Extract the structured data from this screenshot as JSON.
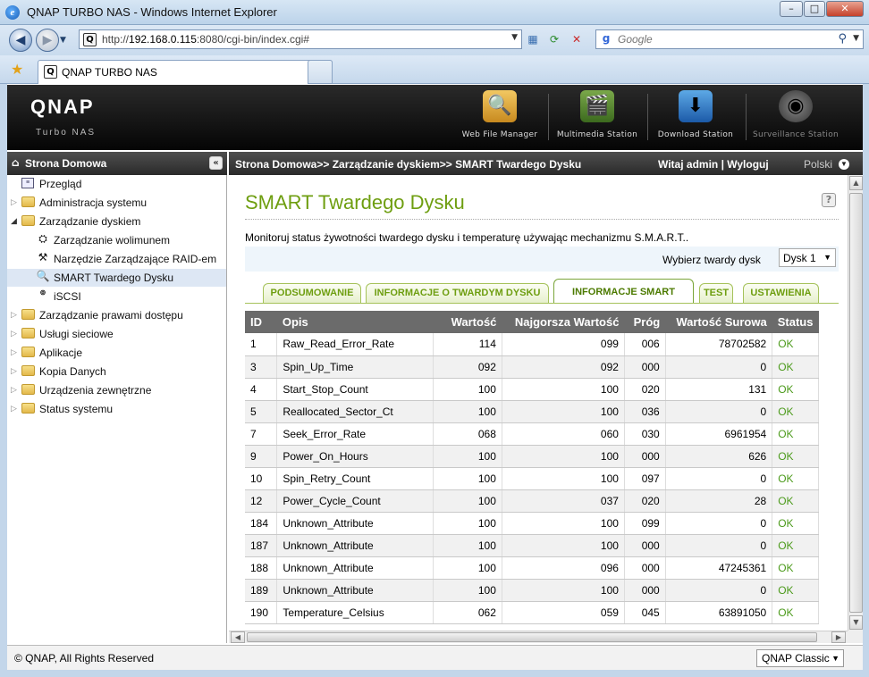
{
  "window": {
    "title": "QNAP TURBO NAS - Windows Internet Explorer",
    "controls": {
      "minimize": "–",
      "maximize": "□",
      "close": "✕"
    }
  },
  "browser": {
    "url_prefix": "http://",
    "url_host": "192.168.0.115",
    "url_rest": ":8080/cgi-bin/index.cgi#",
    "search_placeholder": "Google",
    "tab_title": "QNAP TURBO NAS"
  },
  "header": {
    "logo": "QNAP",
    "subtitle": "Turbo NAS",
    "stations": [
      {
        "label": "Web File Manager",
        "icon": "folder-magnifier-icon"
      },
      {
        "label": "Multimedia Station",
        "icon": "media-icon"
      },
      {
        "label": "Download Station",
        "icon": "download-icon"
      },
      {
        "label": "Surveillance Station",
        "icon": "camera-icon"
      }
    ]
  },
  "sidebar": {
    "title": "Strona Domowa",
    "items": [
      {
        "label": "Przegląd",
        "type": "page",
        "icon": "overview-icon"
      },
      {
        "label": "Administracja systemu",
        "type": "folder",
        "expanded": false
      },
      {
        "label": "Zarządzanie dyskiem",
        "type": "folder",
        "expanded": true
      },
      {
        "label": "Zarządzanie wolimunem",
        "type": "child",
        "icon": "volume-icon"
      },
      {
        "label": "Narzędzie Zarządzające RAID-em",
        "type": "child",
        "icon": "raid-icon"
      },
      {
        "label": "SMART Twardego Dysku",
        "type": "child",
        "icon": "smart-icon",
        "selected": true
      },
      {
        "label": "iSCSI",
        "type": "child",
        "icon": "iscsi-icon"
      },
      {
        "label": "Zarządzanie prawami dostępu",
        "type": "folder",
        "expanded": false
      },
      {
        "label": "Usługi sieciowe",
        "type": "folder",
        "expanded": false
      },
      {
        "label": "Aplikacje",
        "type": "folder",
        "expanded": false
      },
      {
        "label": "Kopia Danych",
        "type": "folder",
        "expanded": false
      },
      {
        "label": "Urządzenia zewnętrzne",
        "type": "folder",
        "expanded": false
      },
      {
        "label": "Status systemu",
        "type": "folder",
        "expanded": false
      }
    ]
  },
  "breadcrumb": {
    "path": "Strona Domowa>> Zarządzanie dyskiem>> SMART Twardego Dysku",
    "user": "Witaj admin | Wyloguj",
    "language": "Polski"
  },
  "main": {
    "title": "SMART Twardego Dysku",
    "description": "Monitoruj status żywotności twardego dysku i temperaturę używając mechanizmu S.M.A.R.T..",
    "disk_select_label": "Wybierz twardy dysk",
    "disk_select_value": "Dysk 1",
    "tabs": [
      {
        "label": "PODSUMOWANIE",
        "active": false
      },
      {
        "label": "INFORMACJE O TWARDYM DYSKU",
        "active": false
      },
      {
        "label": "INFORMACJE SMART",
        "active": true
      },
      {
        "label": "TEST",
        "active": false
      },
      {
        "label": "USTAWIENIA",
        "active": false
      }
    ],
    "table": {
      "columns": [
        "ID",
        "Opis",
        "Wartość",
        "Najgorsza Wartość",
        "Próg",
        "Wartość Surowa",
        "Status"
      ],
      "rows": [
        [
          "1",
          "Raw_Read_Error_Rate",
          "114",
          "099",
          "006",
          "78702582",
          "OK"
        ],
        [
          "3",
          "Spin_Up_Time",
          "092",
          "092",
          "000",
          "0",
          "OK"
        ],
        [
          "4",
          "Start_Stop_Count",
          "100",
          "100",
          "020",
          "131",
          "OK"
        ],
        [
          "5",
          "Reallocated_Sector_Ct",
          "100",
          "100",
          "036",
          "0",
          "OK"
        ],
        [
          "7",
          "Seek_Error_Rate",
          "068",
          "060",
          "030",
          "6961954",
          "OK"
        ],
        [
          "9",
          "Power_On_Hours",
          "100",
          "100",
          "000",
          "626",
          "OK"
        ],
        [
          "10",
          "Spin_Retry_Count",
          "100",
          "100",
          "097",
          "0",
          "OK"
        ],
        [
          "12",
          "Power_Cycle_Count",
          "100",
          "037",
          "020",
          "28",
          "OK"
        ],
        [
          "184",
          "Unknown_Attribute",
          "100",
          "100",
          "099",
          "0",
          "OK"
        ],
        [
          "187",
          "Unknown_Attribute",
          "100",
          "100",
          "000",
          "0",
          "OK"
        ],
        [
          "188",
          "Unknown_Attribute",
          "100",
          "096",
          "000",
          "47245361",
          "OK"
        ],
        [
          "189",
          "Unknown_Attribute",
          "100",
          "100",
          "000",
          "0",
          "OK"
        ],
        [
          "190",
          "Temperature_Celsius",
          "062",
          "059",
          "045",
          "63891050",
          "OK"
        ]
      ]
    }
  },
  "footer": {
    "copyright": "© QNAP, All Rights Reserved",
    "theme": "QNAP Classic"
  }
}
